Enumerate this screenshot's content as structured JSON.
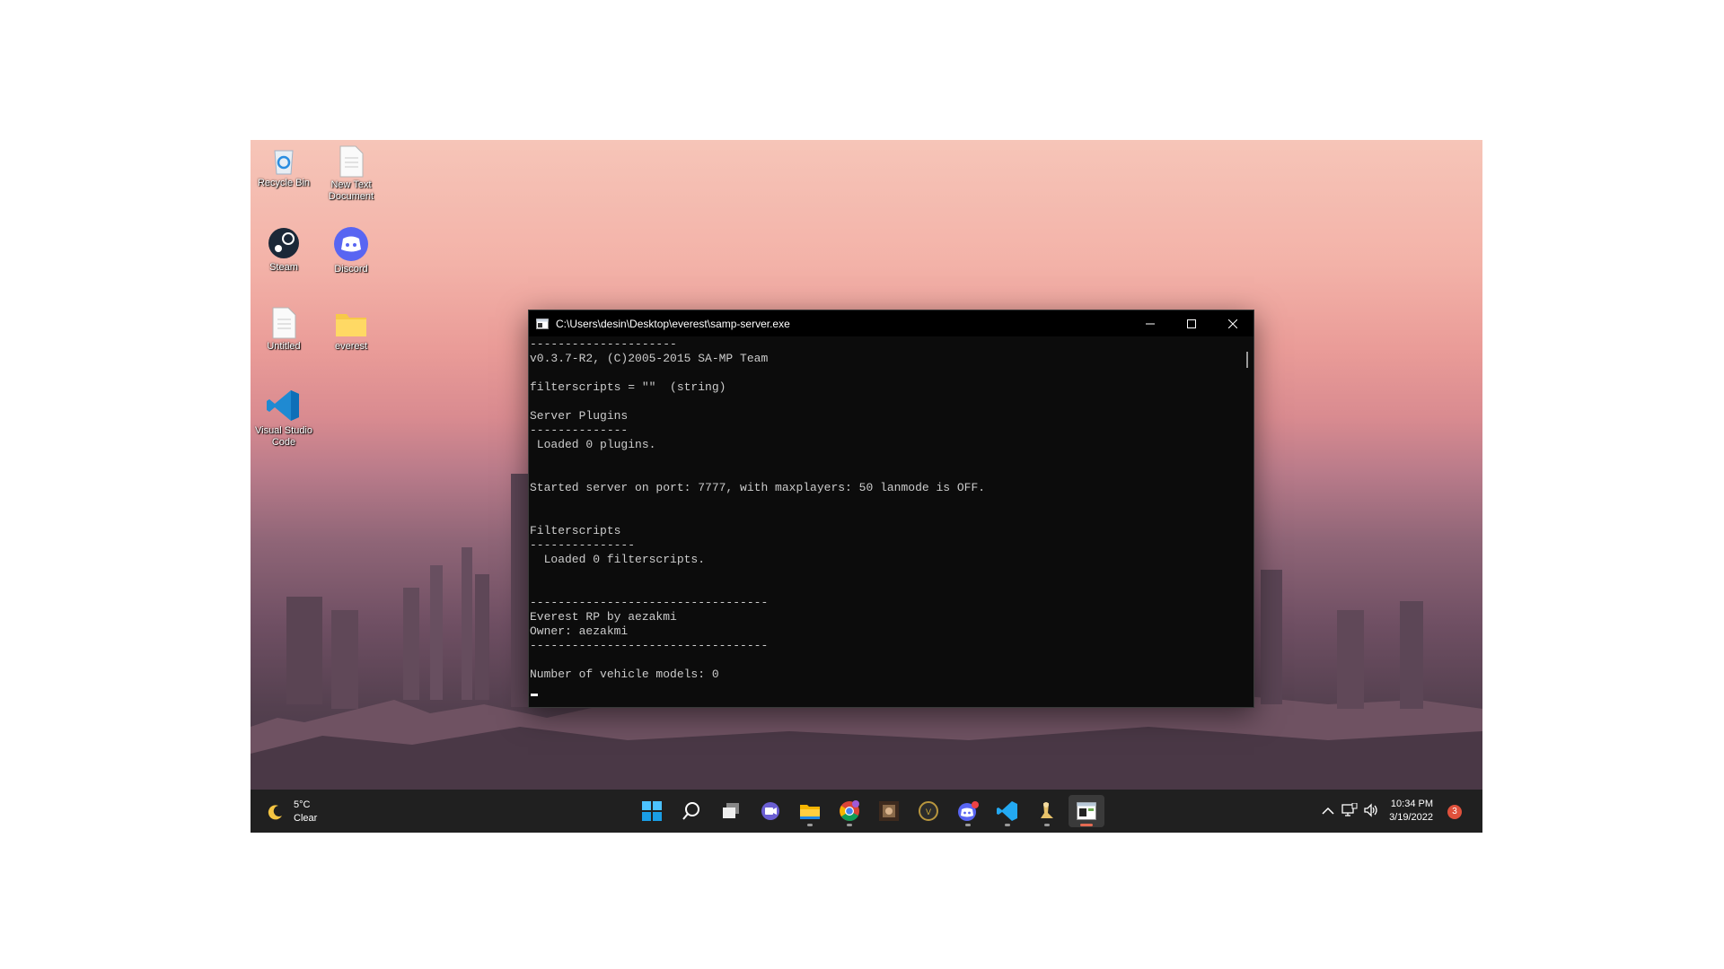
{
  "desktop": {
    "icons": [
      {
        "label": "Recycle Bin",
        "icon": "recycle-bin-icon"
      },
      {
        "label": "New Text\nDocument",
        "icon": "text-document-icon"
      },
      {
        "label": "Steam",
        "icon": "steam-icon"
      },
      {
        "label": "Discord",
        "icon": "discord-icon"
      },
      {
        "label": "Untitled",
        "icon": "text-document-icon"
      },
      {
        "label": "everest",
        "icon": "folder-icon"
      },
      {
        "label": "Visual Studio\nCode",
        "icon": "vscode-icon"
      }
    ]
  },
  "console": {
    "title": "C:\\Users\\desin\\Desktop\\everest\\samp-server.exe",
    "lines": [
      "---------------------",
      "v0.3.7-R2, (C)2005-2015 SA-MP Team",
      "",
      "filterscripts = \"\"  (string)",
      "",
      "Server Plugins",
      "--------------",
      " Loaded 0 plugins.",
      "",
      "",
      "Started server on port: 7777, with maxplayers: 50 lanmode is OFF.",
      "",
      "",
      "Filterscripts",
      "---------------",
      "  Loaded 0 filterscripts.",
      "",
      "",
      "----------------------------------",
      "Everest RP by aezakmi",
      "Owner: aezakmi",
      "----------------------------------",
      "",
      "Number of vehicle models: 0"
    ]
  },
  "taskbar": {
    "weather": {
      "temp": "5°C",
      "condition": "Clear",
      "icon": "moon-icon"
    },
    "apps": [
      "start-icon",
      "search-icon",
      "task-view-icon",
      "teams-chat-icon",
      "file-explorer-icon",
      "chrome-icon",
      "game-icon",
      "gta-icon",
      "discord-icon",
      "vscode-icon",
      "tool-icon",
      "terminal-icon"
    ],
    "clock": {
      "time": "10:34 PM",
      "date": "3/19/2022"
    },
    "notification_count": "3"
  },
  "colors": {
    "taskbar": "#202020",
    "console_bg": "#0c0c0c",
    "console_text": "#cccccc",
    "accent": "#e46a52"
  }
}
